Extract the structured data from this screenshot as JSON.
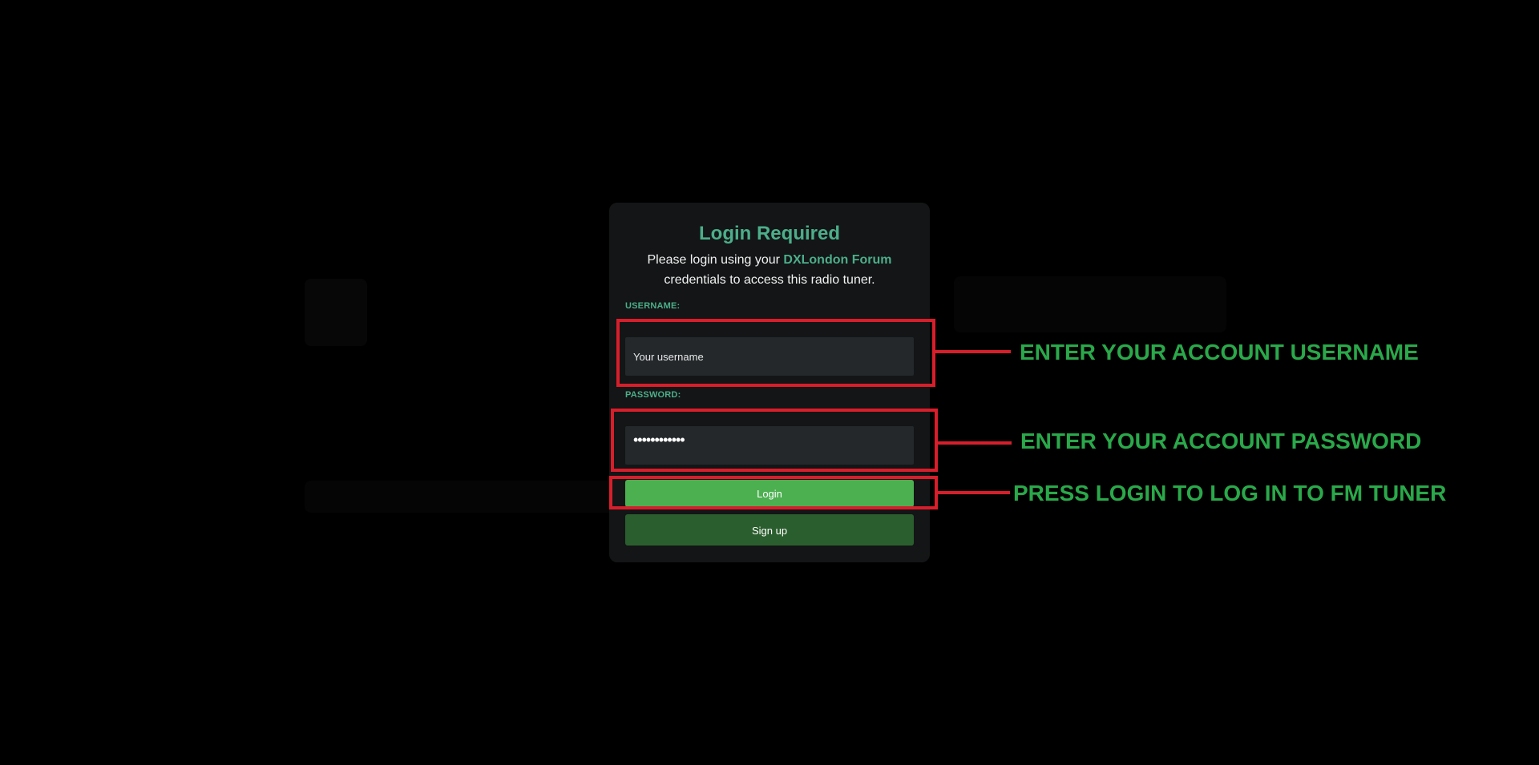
{
  "modal": {
    "title": "Login Required",
    "desc_before": "Please login using your ",
    "desc_link": "DXLondon Forum",
    "desc_after": " credentials to access this radio tuner.",
    "username_label": "USERNAME:",
    "username_placeholder": "Your username",
    "password_label": "PASSWORD:",
    "password_value": "••••••••••••",
    "login_label": "Login",
    "signup_label": "Sign up"
  },
  "annotations": {
    "username": "ENTER YOUR ACCOUNT USERNAME",
    "password": "ENTER YOUR ACCOUNT PASSWORD",
    "login": "PRESS LOGIN TO LOG IN TO FM TUNER"
  },
  "colors": {
    "accent": "#4cae8a",
    "annotation_red": "#d81e2b",
    "annotation_green": "#2aa84a",
    "login_button": "#4caf50",
    "signup_button": "#2b5e2e"
  }
}
